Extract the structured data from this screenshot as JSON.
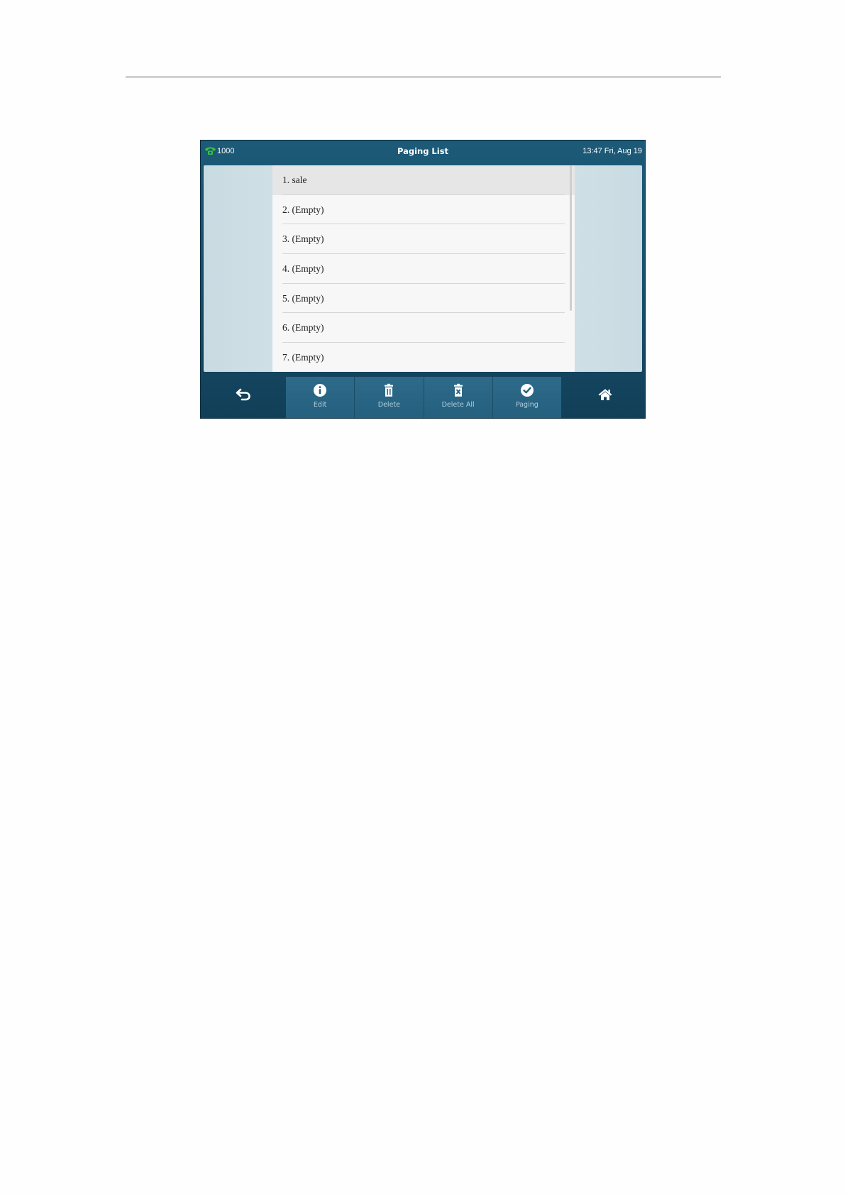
{
  "status_bar": {
    "account": "1000",
    "title": "Paging List",
    "clock": "13:47 Fri, Aug 19"
  },
  "paging_list": {
    "items": [
      {
        "label": "1. sale"
      },
      {
        "label": "2. (Empty)"
      },
      {
        "label": "3. (Empty)"
      },
      {
        "label": "4. (Empty)"
      },
      {
        "label": "5. (Empty)"
      },
      {
        "label": "6. (Empty)"
      },
      {
        "label": "7. (Empty)"
      }
    ]
  },
  "softkeys": {
    "edit": "Edit",
    "delete": "Delete",
    "delete_all": "Delete All",
    "paging": "Paging"
  },
  "icons": {
    "phone": "phone-icon",
    "back": "back-arrow-icon",
    "edit": "info-icon",
    "delete": "trash-icon",
    "delete_all": "trash-x-icon",
    "paging": "checkmark-circle-icon",
    "home": "home-icon"
  },
  "colors": {
    "header_bg": "#1c5a78",
    "phone_icon": "#3bc43b",
    "softkey_bg": "#2e6a89",
    "selected_row": "#e6e6e6"
  }
}
